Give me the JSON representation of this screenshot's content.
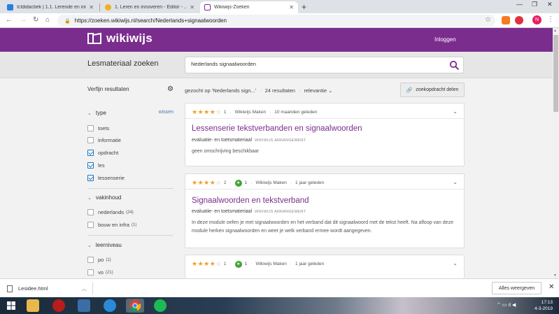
{
  "browser": {
    "tabs": [
      {
        "title": "Ictdidactiek | 1.1. Lerende en inno",
        "active": false
      },
      {
        "title": "1. Leren en innoveren - Editor - ...",
        "active": false
      },
      {
        "title": "Wikiwijs-Zoeken",
        "active": true
      }
    ],
    "url": "https://zoeken.wikiwijs.nl/search/Nederlands+signaalwoorden",
    "profile_initial": "N"
  },
  "site": {
    "logo_text": "wikiwijs",
    "login_label": "Inloggen",
    "brand_color": "#7b2d8e"
  },
  "search": {
    "title": "Lesmateriaal zoeken",
    "query": "Nederlands signaalwoorden"
  },
  "sidebar": {
    "refine_label": "Verfijn resultaten",
    "facets": [
      {
        "title": "type",
        "clear_label": "wissen",
        "options": [
          {
            "label": "toets",
            "checked": false
          },
          {
            "label": "informatie",
            "checked": false
          },
          {
            "label": "opdracht",
            "checked": true
          },
          {
            "label": "les",
            "checked": true
          },
          {
            "label": "lessenserie",
            "checked": true
          }
        ]
      },
      {
        "title": "vakinhoud",
        "options": [
          {
            "label": "nederlands",
            "count": "(24)",
            "checked": false
          },
          {
            "label": "bouw en infra",
            "count": "(1)",
            "checked": false
          }
        ]
      },
      {
        "title": "leerniveau",
        "options": [
          {
            "label": "po",
            "count": "(1)",
            "checked": false
          },
          {
            "label": "vo",
            "count": "(21)",
            "checked": false
          }
        ]
      }
    ]
  },
  "results_header": {
    "searched_for": "gezocht op 'Nederlands sign...'",
    "count": "24 resultaten",
    "sort": "relevantie",
    "share_label": "zoekopdracht delen"
  },
  "results": [
    {
      "rating": 4,
      "rating_count": "1",
      "source": "Wikiwijs Maken",
      "age": "10 maanden geleden",
      "title": "Lessenserie tekstverbanden en signaalwoorden",
      "type": "evaluatie- en toetsmateriaal",
      "type_label": "WIKIWIJS ARRANGEMENT",
      "description": "geen omschrijving beschikbaar"
    },
    {
      "rating": 4,
      "rating_count": "2",
      "badge_count": "1",
      "source": "Wikiwijs Maken",
      "age": "1 jaar geleden",
      "title": "Signaalwoorden en tekstverband",
      "type": "evaluatie- en toetsmateriaal",
      "type_label": "WIKIWIJS ARRANGEMENT",
      "description": "In deze module oefen je met signaalwoorden en het verband dat dit signaalwoord met de tekst heeft. Na afloop van deze module herken signaalwoorden en weet je welk verband ermee wordt aangegeven."
    },
    {
      "rating": 4,
      "rating_count": "1",
      "badge_count": "1",
      "source": "Wikiwijs Maken",
      "age": "1 jaar geleden"
    }
  ],
  "downloads": {
    "file": "Lesidee.html",
    "show_all_label": "Alles weergeven"
  },
  "taskbar": {
    "time": "17:13",
    "date": "4-3-2019"
  }
}
